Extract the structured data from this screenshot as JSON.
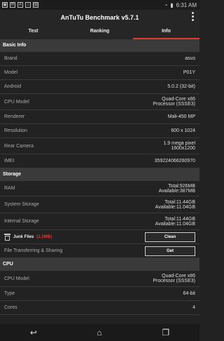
{
  "status": {
    "time": "6:31 AM"
  },
  "app": {
    "title": "AnTuTu Benchmark v5.7.1"
  },
  "tabs": [
    {
      "label": "Test"
    },
    {
      "label": "Ranking"
    },
    {
      "label": "Info"
    }
  ],
  "sections": {
    "basic": {
      "title": "Basic Info",
      "rows": [
        {
          "k": "Brand",
          "v": "asus"
        },
        {
          "k": "Model",
          "v": "P01Y"
        },
        {
          "k": "Android",
          "v": "5.0.2 (32-bit)"
        },
        {
          "k": "CPU Model",
          "v": "Quad-Core x86 Processor (SSSE3)"
        },
        {
          "k": "Renderer",
          "v": "Mali-450 MP"
        },
        {
          "k": "Resolution",
          "v": "600 x 1024"
        },
        {
          "k": "Rear Camera",
          "v": "1.9 mega pixel 1600x1200"
        },
        {
          "k": "IMEI",
          "v": "359224066260970"
        }
      ]
    },
    "storage": {
      "title": "Storage",
      "rows": [
        {
          "k": "RAM",
          "v": "Total:926MB Available:387MB"
        },
        {
          "k": "System Storage",
          "v": "Total:11.44GB Available:11.04GB"
        },
        {
          "k": "Internal Storage",
          "v": "Total:11.44GB Available:11.04GB"
        }
      ],
      "junk": {
        "label": "Junk Files",
        "size": "(1.1MB)",
        "button": "Clean"
      },
      "transfer": {
        "label": "File Transferring & Sharing",
        "button": "Get"
      }
    },
    "cpu": {
      "title": "CPU",
      "rows": [
        {
          "k": "CPU Model",
          "v": "Quad-Core x86 Processor (SSSE3)"
        },
        {
          "k": "Type",
          "v": "64-bit"
        },
        {
          "k": "Cores",
          "v": "4"
        }
      ]
    }
  }
}
